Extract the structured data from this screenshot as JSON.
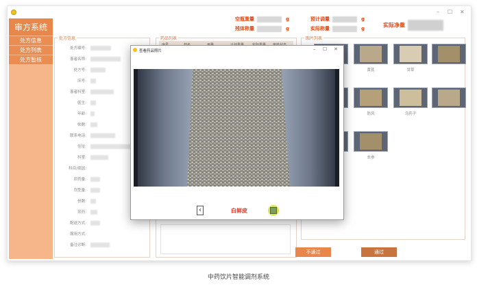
{
  "app": {
    "title": "审方系统"
  },
  "sidebar": {
    "items": [
      {
        "label": "处方信息"
      },
      {
        "label": "处方列表"
      },
      {
        "label": "处方暂核"
      }
    ]
  },
  "header": {
    "stats": [
      {
        "label": "空瓶重量",
        "unit": "g"
      },
      {
        "label": "预计调量",
        "unit": "g"
      },
      {
        "label": "残体称量",
        "unit": "g"
      },
      {
        "label": "实际称量",
        "unit": "g"
      }
    ],
    "net_label": "实际净重"
  },
  "prescription_panel": {
    "title": "处方信息",
    "fields": [
      "处方编号:",
      "患者名称:",
      "处方号:",
      "床号:",
      "患者科室:",
      "医生:",
      "年龄:",
      "帖数:",
      "联系电话:",
      "住址:",
      "科室:",
      "科目/病因:",
      "煎药量:",
      "剂型量:",
      "份数:",
      "煎药:",
      "配送方式:",
      "服用方式:",
      "备注诊断:"
    ]
  },
  "drug_panel": {
    "title": "药品列表",
    "columns": [
      "序号",
      "药名",
      "用量",
      "计划重量",
      "实际重量",
      "审核状态"
    ]
  },
  "photo_panel": {
    "title": "图片列表",
    "herbs": [
      "",
      "",
      "",
      "茯苓",
      "黄芪",
      "甘草",
      "",
      "",
      "",
      "黎芦",
      "防风",
      "乌药子",
      "",
      "",
      "",
      "白鲜皮",
      "玄参",
      ""
    ]
  },
  "dialog": {
    "title": "查看药品照片",
    "herb_name": "白鲜皮",
    "prev_icon": "chevron-left-icon",
    "next_icon": "thumbnail-icon"
  },
  "buttons": {
    "reject": "不通过",
    "approve": "通过"
  },
  "caption": "中药饮片智能调剂系统",
  "colors": {
    "accent": "#e9874a",
    "sidebar": "#f6b68a",
    "alert": "#e04a14"
  }
}
